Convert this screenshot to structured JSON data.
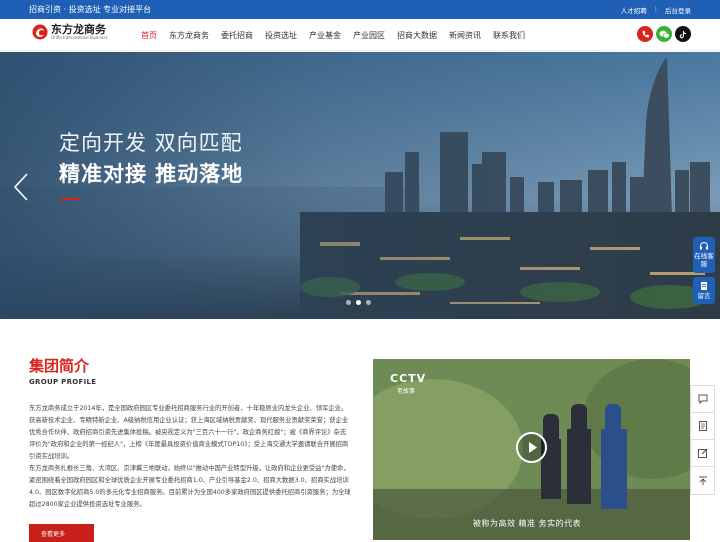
{
  "topbar": {
    "slogan": "招商引资 · 投资选址 专业对接平台",
    "links": [
      "人才招聘",
      "后台登录"
    ]
  },
  "logo": {
    "name_cn": "东方龙商务",
    "name_en": "Oriflo International Business"
  },
  "nav": {
    "items": [
      "首页",
      "东方龙商务",
      "委托招商",
      "投资选址",
      "产业基金",
      "产业园区",
      "招商大数据",
      "新闻资讯",
      "联系我们"
    ],
    "active_index": 0
  },
  "social_icons": [
    "phone-icon",
    "wechat-icon",
    "tiktok-icon"
  ],
  "hero": {
    "line1": "定向开发 双向匹配",
    "line2": "精准对接 推动落地",
    "slides": 3,
    "active_slide": 1
  },
  "float_service": [
    {
      "label": "在线客服",
      "icon": "headset-icon"
    },
    {
      "label": "留言",
      "icon": "note-icon"
    }
  ],
  "profile": {
    "title_cn": "集团简介",
    "title_en": "GROUP PROFILE",
    "para1": "东方龙商务成立于2014年，是全国政府园区专业委托招商服务行业的开创者，十年稳居业内龙头企业、领军企业。获高新技术企业、专精特新企业、A级纳税信用企业认证；获上海区域纳税贡献奖、现代服务业贡献奖荣誉；获企业优秀合作伙伴、政府招商引资先进集体投稿。被央视定义为\"三百六十一行\"，政企商务红娘\"；被《商界评论》杂志评价为\"政府和企业的第一经纪人\"，上榜《年度最具投资价值商业模式TOP10》；受上海交通大学邀请联合开展招商引资实战培训。",
    "para2": "东方龙商务扎根长三角、大湾区、京津冀三地联动，始终以\"推动中国产业转型升级，让政府和企业更受益\"为使命，紧密围绕着全国政府园区和全球优质企业开展专业委托招商1.0、产业引导基金2.0、招商大数据3.0、招商实战培训4.0、园区数字化招商5.0的多元化专业招商服务。目前累计为全国400多家政府园区提供委托招商引资服务；为全球超过2800家企业提供投资选址专业服务。",
    "more_label": "查看更多"
  },
  "video": {
    "brand": "CCTV",
    "brand_sub": "老故事",
    "caption": "被称为高效 精准 务实的代表"
  },
  "tools": [
    "message-icon",
    "document-icon",
    "edit-icon",
    "back-to-top-icon"
  ],
  "colors": {
    "brand_blue": "#1f5fb5",
    "brand_red": "#d9231d"
  }
}
